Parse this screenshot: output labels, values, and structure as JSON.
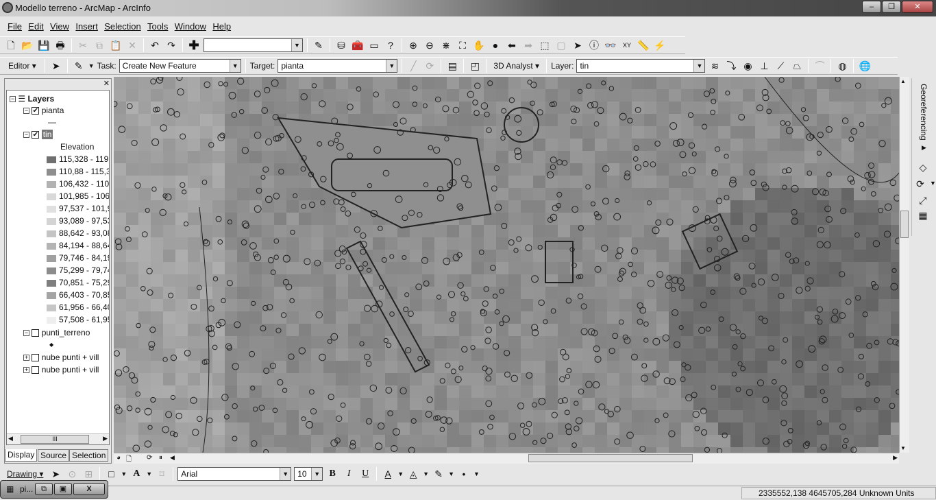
{
  "window": {
    "title": "Modello terreno - ArcMap - ArcInfo",
    "controls": [
      "–",
      "❐",
      "✕"
    ]
  },
  "menu": [
    "File",
    "Edit",
    "View",
    "Insert",
    "Selection",
    "Tools",
    "Window",
    "Help"
  ],
  "editor": {
    "label": "Editor",
    "task_label": "Task:",
    "task_value": "Create New Feature",
    "target_label": "Target:",
    "target_value": "pianta"
  },
  "analyst": {
    "label": "3D Analyst",
    "layer_label": "Layer:",
    "layer_value": "tin"
  },
  "toc": {
    "root": "Layers",
    "layers": [
      {
        "name": "pianta",
        "checked": true,
        "expanded": true
      },
      {
        "name": "tin",
        "checked": true,
        "expanded": true,
        "legend_title": "Elevation"
      },
      {
        "name": "punti_terreno",
        "checked": false,
        "expanded": true
      },
      {
        "name": "nube punti + vill",
        "checked": false,
        "expanded": false
      },
      {
        "name": "nube punti + vill",
        "checked": false,
        "expanded": false
      }
    ],
    "elevation_classes": [
      {
        "label": "115,328 - 119,",
        "color": "#707070"
      },
      {
        "label": "110,88 - 115,3",
        "color": "#8e8e8e"
      },
      {
        "label": "106,432 - 110,",
        "color": "#b2b2b2"
      },
      {
        "label": "101,985 - 106,",
        "color": "#d8d8d8"
      },
      {
        "label": "97,537 - 101,9",
        "color": "#e0e0e0"
      },
      {
        "label": "93,089 - 97,53",
        "color": "#d4d4d4"
      },
      {
        "label": "88,642 - 93,08",
        "color": "#c4c4c4"
      },
      {
        "label": "84,194 - 88,64",
        "color": "#b4b4b4"
      },
      {
        "label": "79,746 - 84,19",
        "color": "#a0a0a0"
      },
      {
        "label": "75,299 - 79,74",
        "color": "#8c8c8c"
      },
      {
        "label": "70,851 - 75,29",
        "color": "#7e7e7e"
      },
      {
        "label": "66,403 - 70,85",
        "color": "#a4a4a4"
      },
      {
        "label": "61,956 - 66,40",
        "color": "#c6c6c6"
      },
      {
        "label": "57,508 - 61,95",
        "color": "#eeeeee"
      }
    ],
    "tabs": [
      "Display",
      "Source",
      "Selection"
    ],
    "scroll_thumb": "III"
  },
  "georef": {
    "label": "Georeferencing"
  },
  "drawing": {
    "label": "Drawing",
    "font": "Arial",
    "size": "10",
    "bold": "B",
    "italic": "I",
    "underline": "U"
  },
  "taskbar": {
    "label": "pi..."
  },
  "status": {
    "coords": "2335552,138  4645705,284 Unknown Units"
  }
}
